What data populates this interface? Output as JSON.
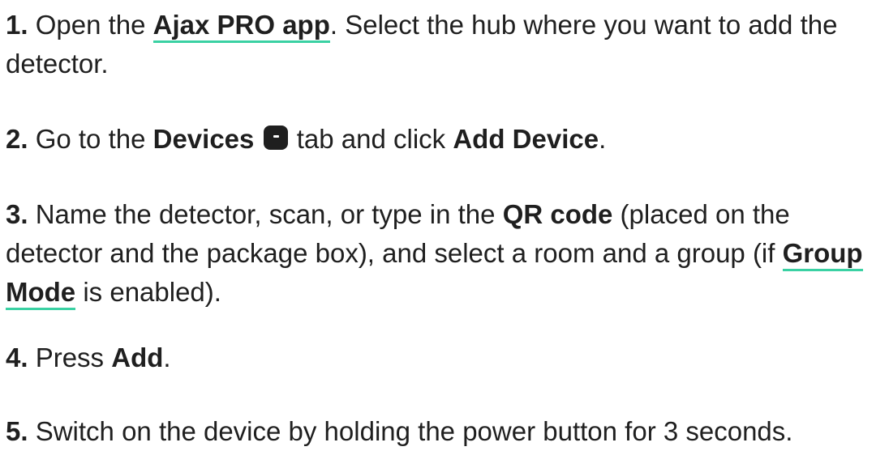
{
  "steps": [
    {
      "num": "1.",
      "t1": " Open the ",
      "link": "Ajax PRO app",
      "t2": ". Select the hub where you want to add the detector."
    },
    {
      "num": "2.",
      "t1": " Go to the ",
      "b1": "Devices",
      "icon": "devices-icon",
      "t2": " tab and click ",
      "b2": "Add Device",
      "t3": "."
    },
    {
      "num": "3.",
      "t1": " Name the detector, scan, or type in the ",
      "b1": "QR code",
      "t2": " (placed on the detector and the package box), and select a room and a group (if ",
      "link": "Group Mode",
      "t3": " is enabled)."
    },
    {
      "num": "4.",
      "t1": " Press ",
      "b1": "Add",
      "t2": "."
    },
    {
      "num": "5.",
      "t1": " Switch on the device by holding the power button for 3 seconds."
    }
  ]
}
